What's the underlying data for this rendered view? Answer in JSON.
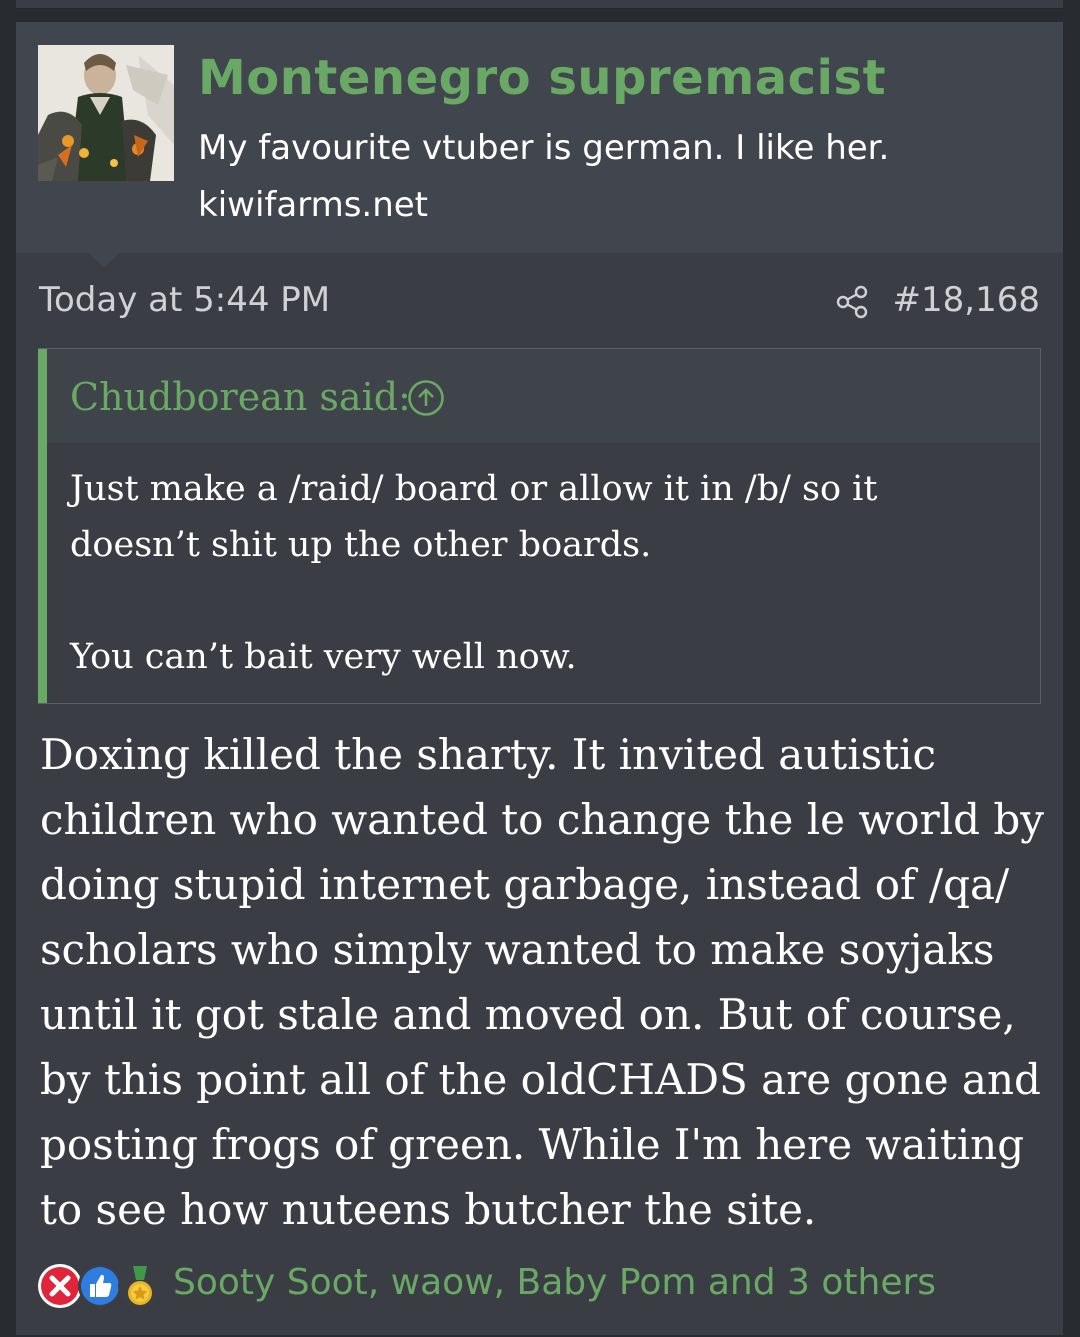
{
  "post": {
    "author": {
      "username": "Montenegro supremacist",
      "title": "My favourite vtuber is german. I like her.",
      "site": "kiwifarms.net",
      "avatar_icon": "avatar-image"
    },
    "date": "Today at 5:44 PM",
    "number": "#18,168",
    "share_icon": "share-icon",
    "quote": {
      "author_line": "Chudborean said:",
      "jump_icon": "arrow-up-circle-icon",
      "paragraphs": [
        "Just make a /raid/ board or allow it in /b/ so it doesn’t shit up the other boards.",
        "You can’t bait very well now."
      ]
    },
    "body": "Doxing killed the sharty. It invited autistic children who wanted to change the le world by doing stupid internet garbage, instead of /qa/ scholars who simply wanted to make soyjaks until it got stale and moved on. But of course, by this point all of the oldCHADS are gone and posting frogs of green. While I'm here waiting to see how nuteens butcher the site.",
    "reactions": {
      "icons": [
        "x-reaction-icon",
        "thumbs-up-reaction-icon",
        "medal-reaction-icon"
      ],
      "summary": "Sooty Soot, waow, Baby Pom and 3 others"
    }
  },
  "colors": {
    "accent_green": "#6aa865",
    "page_bg": "#282b30",
    "post_bg": "#3a3e44",
    "header_bg": "#41454d"
  }
}
